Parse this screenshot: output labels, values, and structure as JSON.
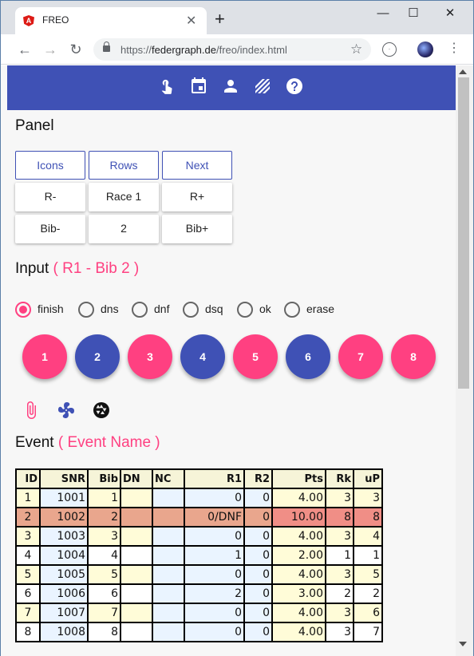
{
  "browser": {
    "tab_title": "FREO",
    "favicon_letter": "A",
    "tab_close": "✕",
    "new_tab": "+",
    "window_controls": [
      "—",
      "☐",
      "✕"
    ],
    "url_scheme": "https://",
    "url_host": "federgraph.de",
    "url_path": "/freo/index.html"
  },
  "toolbar": {
    "icons": [
      "touch-icon",
      "calendar-icon",
      "person-icon",
      "stripes-icon",
      "help-icon"
    ]
  },
  "panel": {
    "title": "Panel",
    "row1": [
      "Icons",
      "Rows",
      "Next"
    ],
    "row2": [
      "R-",
      "Race 1",
      "R+"
    ],
    "row3": [
      "Bib-",
      "2",
      "Bib+"
    ]
  },
  "input": {
    "title": "Input",
    "context": "( R1 - Bib 2 )",
    "radios": [
      "finish",
      "dns",
      "dnf",
      "dsq",
      "ok",
      "erase"
    ],
    "selected_radio": "finish",
    "fabs": [
      "1",
      "2",
      "3",
      "4",
      "5",
      "6",
      "7",
      "8"
    ]
  },
  "event": {
    "title": "Event",
    "name": "( Event Name )",
    "columns": [
      "ID",
      "SNR",
      "Bib",
      "DN",
      "NC",
      "R1",
      "R2",
      "Pts",
      "Rk",
      "uP"
    ],
    "rows": [
      [
        "1",
        "1001",
        "1",
        "",
        "",
        "0",
        "0",
        "4.00",
        "3",
        "3"
      ],
      [
        "2",
        "1002",
        "2",
        "",
        "",
        "0/DNF",
        "0",
        "10.00",
        "8",
        "8"
      ],
      [
        "3",
        "1003",
        "3",
        "",
        "",
        "0",
        "0",
        "4.00",
        "3",
        "4"
      ],
      [
        "4",
        "1004",
        "4",
        "",
        "",
        "1",
        "0",
        "2.00",
        "1",
        "1"
      ],
      [
        "5",
        "1005",
        "5",
        "",
        "",
        "0",
        "0",
        "4.00",
        "3",
        "5"
      ],
      [
        "6",
        "1006",
        "6",
        "",
        "",
        "2",
        "0",
        "3.00",
        "2",
        "2"
      ],
      [
        "7",
        "1007",
        "7",
        "",
        "",
        "0",
        "0",
        "4.00",
        "3",
        "6"
      ],
      [
        "8",
        "1008",
        "8",
        "",
        "",
        "0",
        "0",
        "4.00",
        "3",
        "7"
      ]
    ]
  },
  "colors": {
    "primary": "#3f51b5",
    "accent": "#ff4081"
  }
}
